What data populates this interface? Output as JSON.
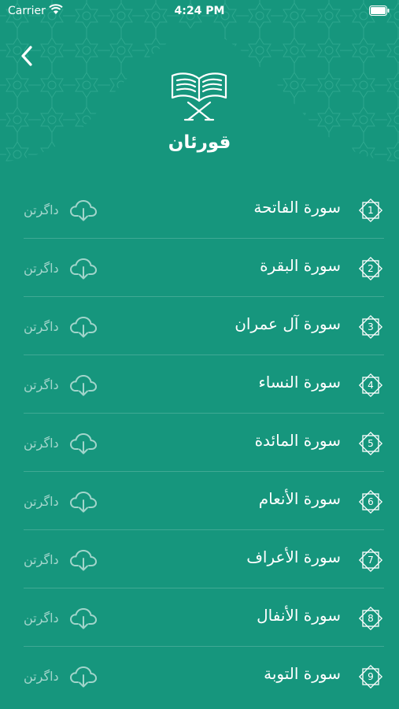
{
  "status_bar": {
    "carrier": "Carrier",
    "time": "4:24 PM"
  },
  "header": {
    "title": "قورئان",
    "back_icon": "chevron-left-icon",
    "book_icon": "quran-stand-icon"
  },
  "download_label": "داگرتن",
  "surahs": [
    {
      "number": "1",
      "name": "سورة الفاتحة"
    },
    {
      "number": "2",
      "name": "سورة البقرة"
    },
    {
      "number": "3",
      "name": "سورة آل عمران"
    },
    {
      "number": "4",
      "name": "سورة النساء"
    },
    {
      "number": "5",
      "name": "سورة المائدة"
    },
    {
      "number": "6",
      "name": "سورة الأنعام"
    },
    {
      "number": "7",
      "name": "سورة الأعراف"
    },
    {
      "number": "8",
      "name": "سورة الأنفال"
    },
    {
      "number": "9",
      "name": "سورة التوبة"
    }
  ],
  "colors": {
    "background": "#16967d",
    "pattern": "#2aa890"
  }
}
